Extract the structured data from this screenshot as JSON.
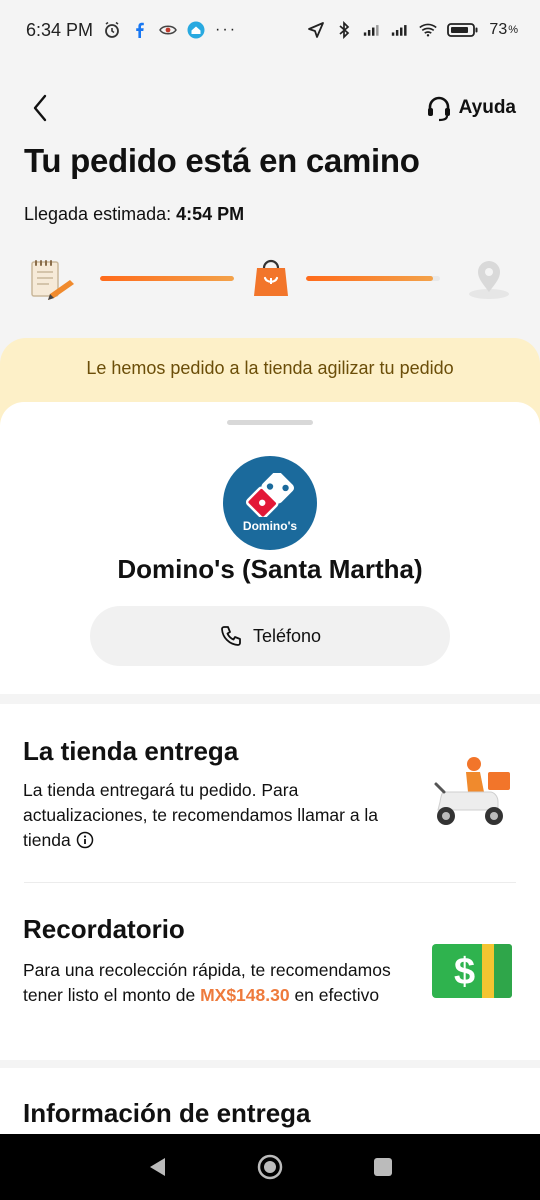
{
  "status_bar": {
    "time": "6:34 PM",
    "battery_pct": "73",
    "dots": "···"
  },
  "header": {
    "help_label": "Ayuda"
  },
  "order": {
    "title": "Tu pedido está en camino",
    "eta_label": "Llegada estimada:",
    "eta_time": "4:54 PM",
    "progress_step1": 1.0,
    "progress_step2": 0.95
  },
  "banner": {
    "text": "Le hemos pedido a la tienda agilizar tu pedido"
  },
  "store": {
    "logo_text": "Domino's",
    "name": "Domino's (Santa Martha)",
    "phone_label": "Teléfono"
  },
  "delivery_section": {
    "title": "La tienda entrega",
    "text": "La tienda entregará tu pedido. Para actualizaciones, te recomendamos llamar a la tienda"
  },
  "reminder_section": {
    "title": "Recordatorio",
    "text_before": "Para una recolección rápida, te recomendamos tener listo el monto de",
    "amount": "MX$148.30",
    "text_after": "en efectivo"
  },
  "info_section": {
    "title": "Información de entrega"
  },
  "colors": {
    "accent": "#ff6a1a",
    "banner_bg": "#fdf0c8",
    "amount": "#ee7a3c",
    "dominos_blue": "#1b6a9c"
  }
}
